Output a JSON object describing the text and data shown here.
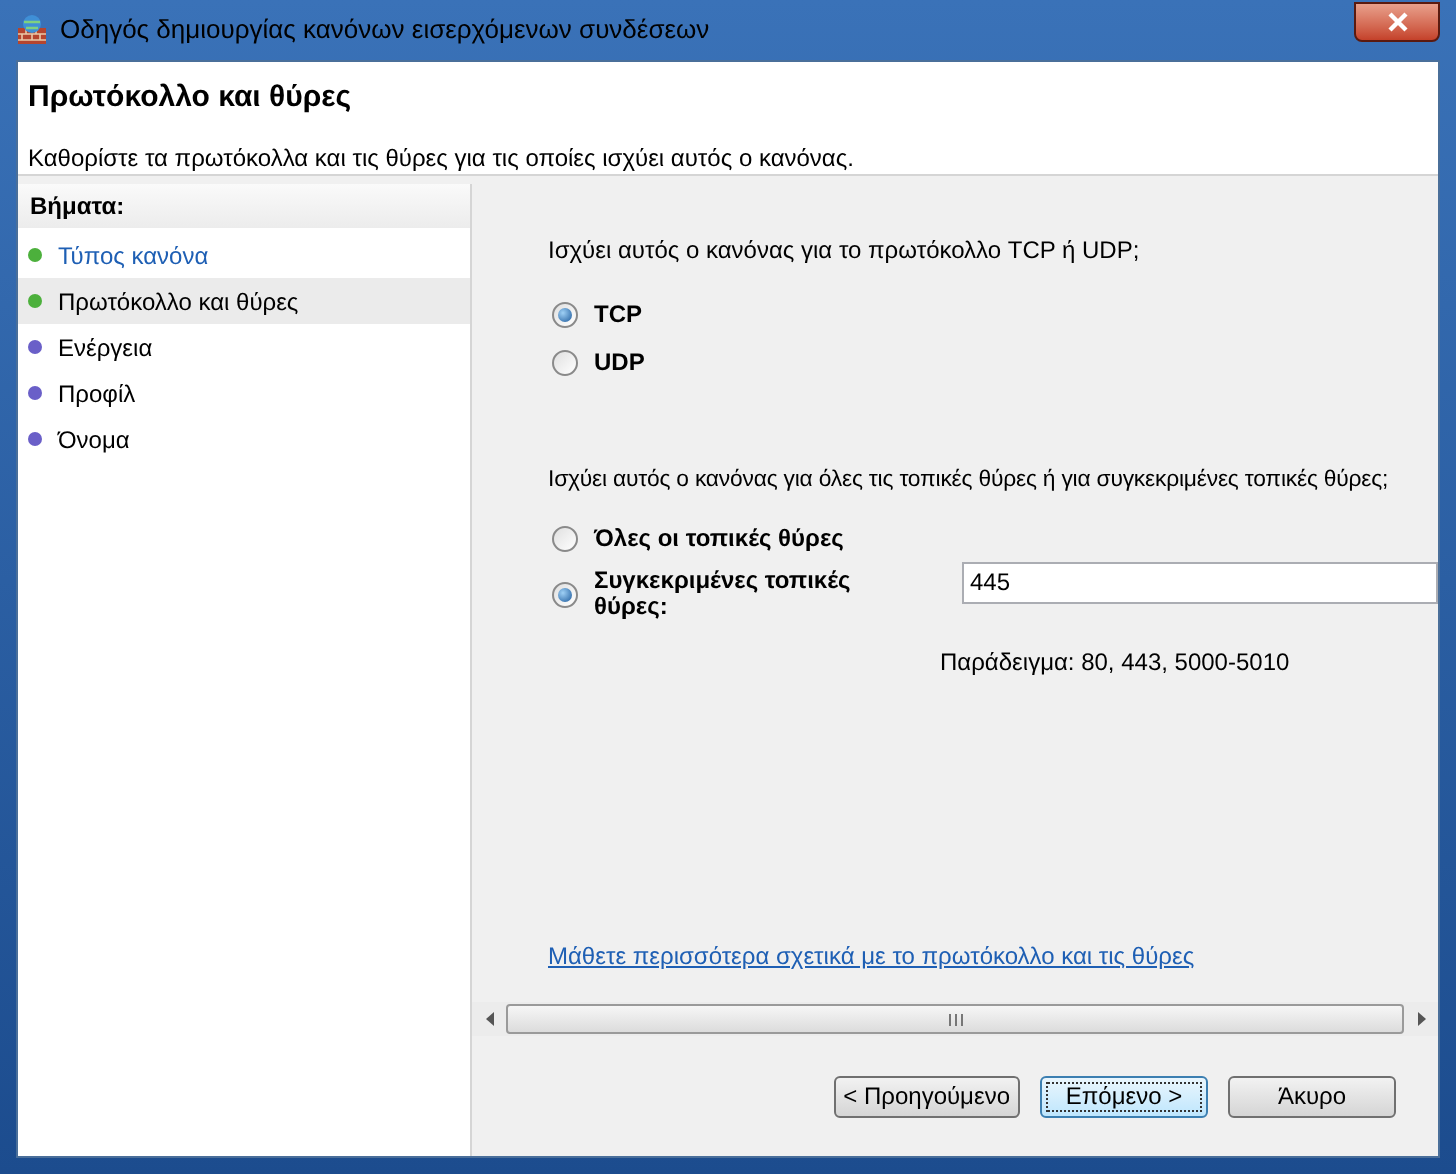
{
  "window": {
    "title": "Οδηγός δημιουργίας κανόνων εισερχόμενων συνδέσεων"
  },
  "header": {
    "title": "Πρωτόκολλο και θύρες",
    "description": "Καθορίστε τα πρωτόκολλα και τις θύρες για τις οποίες ισχύει αυτός ο κανόνας."
  },
  "steps": {
    "title": "Βήματα:",
    "items": [
      {
        "label": "Τύπος κανόνα",
        "kind": "link",
        "selected": false,
        "color": "#4cb03c"
      },
      {
        "label": "Πρωτόκολλο και θύρες",
        "kind": "text",
        "selected": true,
        "color": "#4cb03c"
      },
      {
        "label": "Ενέργεια",
        "kind": "text",
        "selected": false,
        "color": "#6a5fc8"
      },
      {
        "label": "Προφίλ",
        "kind": "text",
        "selected": false,
        "color": "#6a5fc8"
      },
      {
        "label": "Όνομα",
        "kind": "text",
        "selected": false,
        "color": "#6a5fc8"
      }
    ]
  },
  "protocol": {
    "question": "Ισχύει αυτός ο κανόνας για το πρωτόκολλο TCP ή UDP;",
    "options": [
      {
        "label": "TCP",
        "selected": true
      },
      {
        "label": "UDP",
        "selected": false
      }
    ]
  },
  "ports": {
    "question": "Ισχύει αυτός ο κανόνας για όλες τις τοπικές θύρες ή για συγκεκριμένες τοπικές θύρες;",
    "options": [
      {
        "label": "Όλες οι τοπικές θύρες",
        "selected": false
      },
      {
        "label": "Συγκεκριμένες τοπικές θύρες:",
        "selected": true
      }
    ],
    "value": "445",
    "example": "Παράδειγμα: 80, 443, 5000-5010"
  },
  "link": "Μάθετε περισσότερα σχετικά με το πρωτόκολλο και τις θύρες",
  "buttons": [
    {
      "label": "< Προηγούμενο",
      "focused": false
    },
    {
      "label": "Επόμενο >",
      "focused": true
    },
    {
      "label": "Άκυρο",
      "focused": false
    }
  ]
}
